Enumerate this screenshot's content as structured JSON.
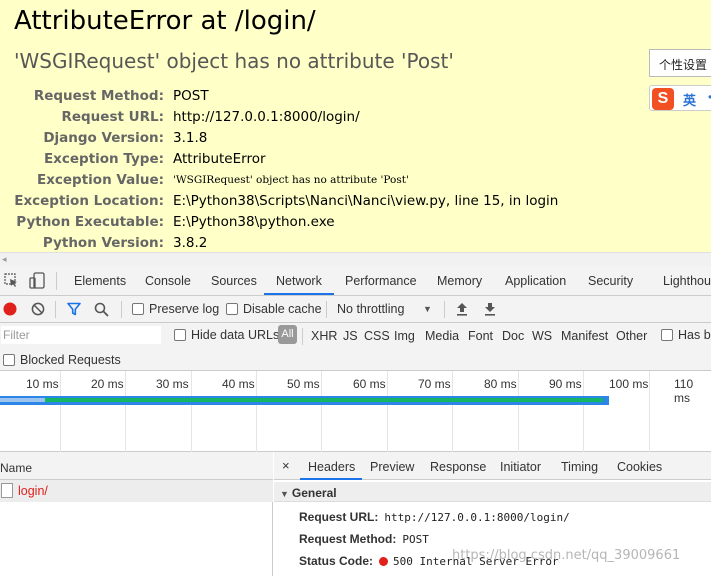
{
  "error_page": {
    "title": "AttributeError at /login/",
    "subtitle": "'WSGIRequest' object has no attribute 'Post'",
    "meta": [
      {
        "key": "Request Method:",
        "value": "POST"
      },
      {
        "key": "Request URL:",
        "value": "http://127.0.0.1:8000/login/"
      },
      {
        "key": "Django Version:",
        "value": "3.1.8"
      },
      {
        "key": "Exception Type:",
        "value": "AttributeError"
      },
      {
        "key": "Exception Value:",
        "value": "'WSGIRequest' object has no attribute 'Post'"
      },
      {
        "key": "Exception Location:",
        "value": "E:\\Python38\\Scripts\\Nanci\\Nanci\\view.py, line 15, in login"
      },
      {
        "key": "Python Executable:",
        "value": "E:\\Python38\\python.exe"
      },
      {
        "key": "Python Version:",
        "value": "3.8.2"
      }
    ],
    "scroll_arrow": "◂"
  },
  "ime": {
    "tooltip": "个性设置",
    "logo": "S",
    "lang": "英",
    "more": "•"
  },
  "devtools": {
    "tabs": [
      "Elements",
      "Console",
      "Sources",
      "Network",
      "Performance",
      "Memory",
      "Application",
      "Security",
      "Lighthou"
    ],
    "active_tab": "Network",
    "toolbar": {
      "preserve_log": "Preserve log",
      "disable_cache": "Disable cache",
      "throttling": "No throttling",
      "throttling_arrow": "▼"
    },
    "filter": {
      "placeholder": "Filter",
      "hide_data_urls": "Hide data URLs",
      "all": "All",
      "types": [
        "XHR",
        "JS",
        "CSS",
        "Img",
        "Media",
        "Font",
        "Doc",
        "WS",
        "Manifest",
        "Other"
      ],
      "has_blocked": "Has bl"
    },
    "blocked_requests": "Blocked Requests",
    "timeline_ticks": [
      "10 ms",
      "20 ms",
      "30 ms",
      "40 ms",
      "50 ms",
      "60 ms",
      "70 ms",
      "80 ms",
      "90 ms",
      "100 ms",
      "110 ms"
    ],
    "list": {
      "header": "Name",
      "rows": [
        {
          "name": "login/"
        }
      ]
    },
    "detail": {
      "close": "×",
      "tabs": [
        "Headers",
        "Preview",
        "Response",
        "Initiator",
        "Timing",
        "Cookies"
      ],
      "active_tab": "Headers",
      "section": "General",
      "section_arrow": "▼",
      "headers": [
        {
          "key": "Request URL:",
          "value": "http://127.0.0.1:8000/login/"
        },
        {
          "key": "Request Method:",
          "value": "POST"
        },
        {
          "key": "Status Code:",
          "value": "500 Internal Server Error"
        }
      ]
    }
  },
  "watermark": "https://blog.csdn.net/qq_39009661",
  "colors": {
    "error_bg": "#ffffc8",
    "accent": "#1a73e8",
    "error_red": "#e0201a",
    "timeline_blue": "#2c86e8",
    "timeline_green": "#14b565"
  }
}
